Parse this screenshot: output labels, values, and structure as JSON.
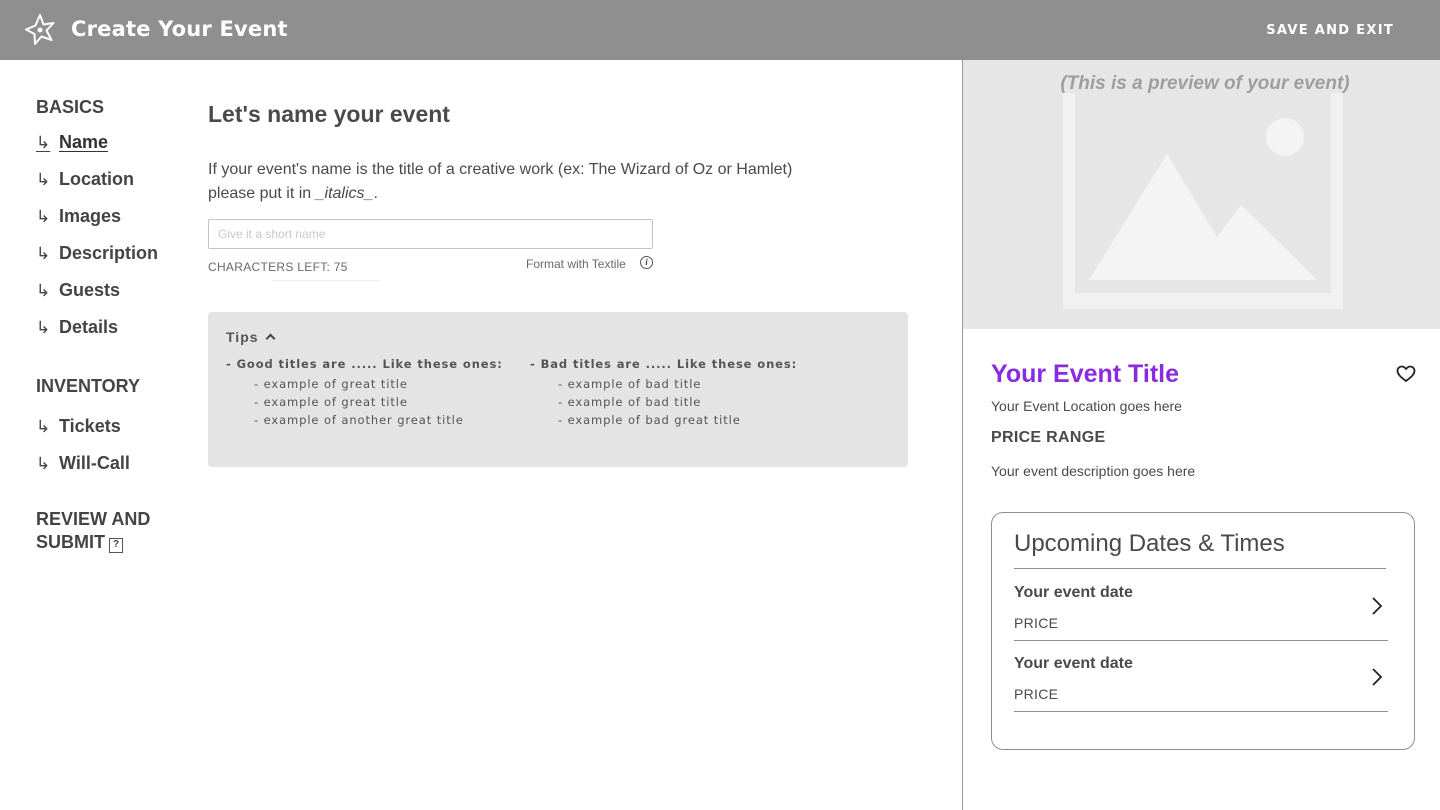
{
  "header": {
    "app_title": "Create Your Event",
    "save_exit_label": "SAVE AND EXIT",
    "logo_icon": "star-flower-icon",
    "background_color": "#8f8f8f"
  },
  "sidebar": {
    "sections": [
      {
        "title": "BASICS",
        "items": [
          {
            "label": "Name",
            "active": true
          },
          {
            "label": "Location"
          },
          {
            "label": "Images"
          },
          {
            "label": "Description"
          },
          {
            "label": "Guests"
          },
          {
            "label": "Details"
          }
        ]
      },
      {
        "title": "INVENTORY",
        "items": [
          {
            "label": "Tickets"
          },
          {
            "label": "Will-Call"
          }
        ]
      }
    ],
    "review_line1": "REVIEW AND",
    "review_line2": "SUBMIT",
    "review_icon": "key-icon",
    "arrow_glyph": "↳"
  },
  "main": {
    "title": "Let's name your event",
    "intro_line1": "If your event's name is the title of a creative work (ex: The Wizard of Oz or Hamlet)",
    "intro_line2_prefix": "please put it in ",
    "intro_line2_italic": "_italics_",
    "intro_line2_suffix": ".",
    "name_input": {
      "value": "",
      "placeholder": "Give it a short name"
    },
    "chars_left": "CHARACTERS LEFT: 75",
    "format_link": "Format with Textile",
    "tips": {
      "label": "Tips",
      "good": {
        "head": "- Good titles are ..... Like these ones:",
        "lines": [
          "- example of great title",
          "- example of great title",
          "- example of another great title"
        ]
      },
      "bad": {
        "head": "- Bad titles are ..... Like these ones:",
        "lines": [
          "- example of bad title",
          "- example of bad title",
          "- example of bad great title"
        ]
      }
    }
  },
  "preview": {
    "note": "(This is a preview of your event)",
    "event_title": "Your Event Title",
    "title_color": "#8a2be2",
    "location": "Your Event Location goes here",
    "price_range": "PRICE RANGE",
    "description": "Your event description goes here",
    "dates_heading": "Upcoming Dates & Times",
    "dates": [
      {
        "title": "Your event date",
        "price": "PRICE"
      },
      {
        "title": "Your event date",
        "price": "PRICE"
      }
    ]
  }
}
